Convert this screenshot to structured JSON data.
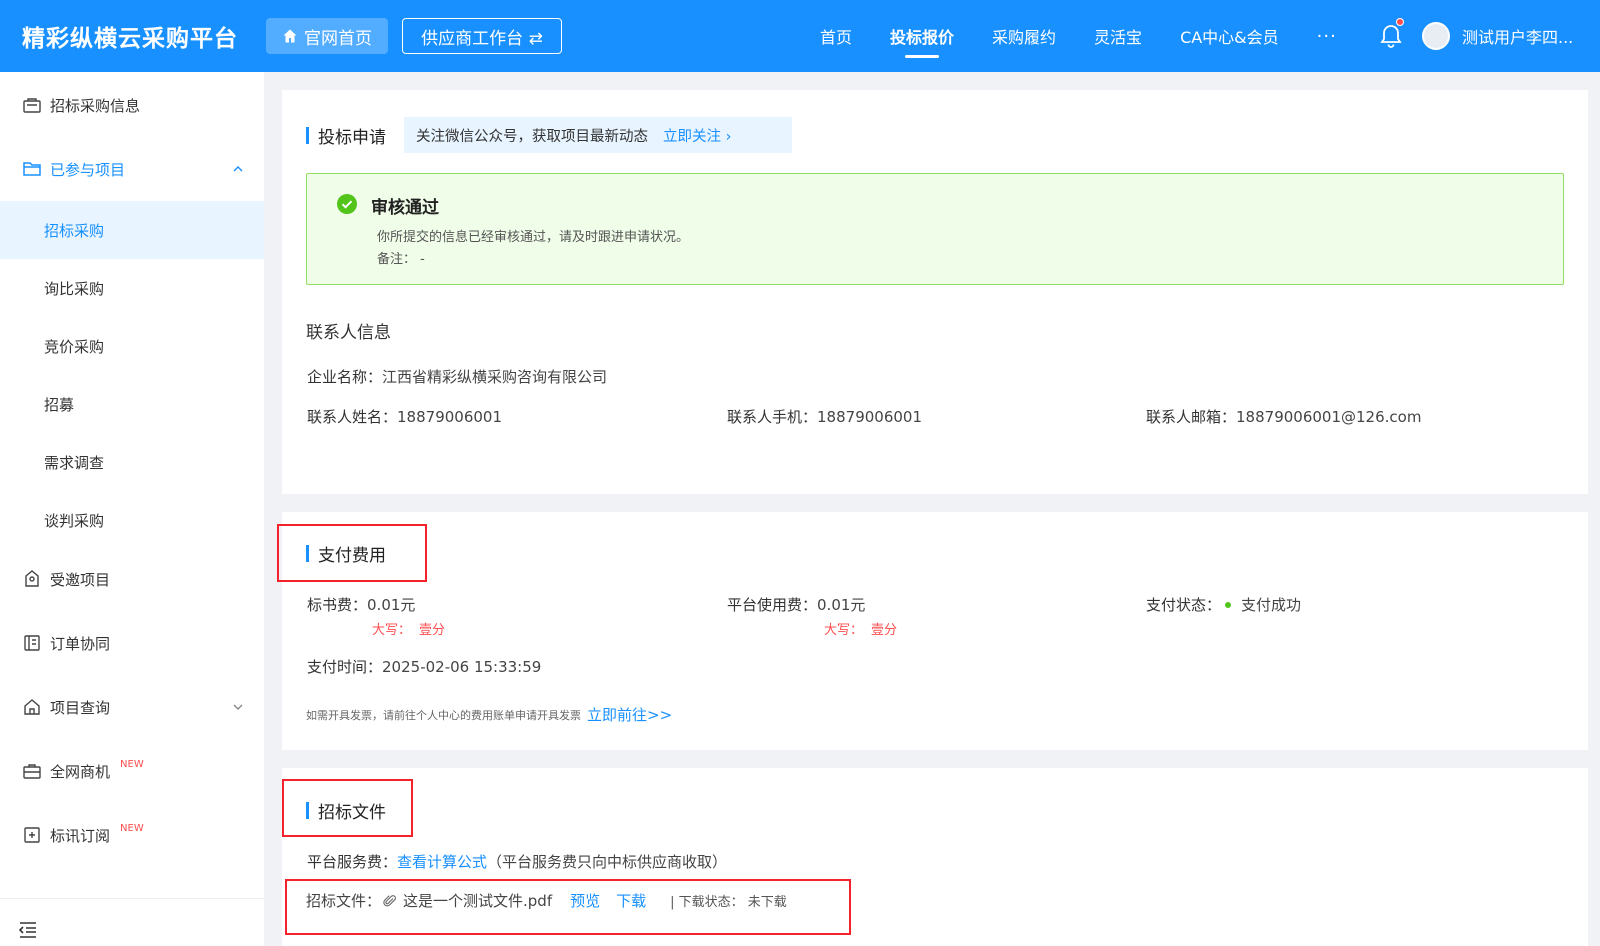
{
  "header": {
    "brand": "精彩纵横云采购平台",
    "home_btn": "官网首页",
    "workbench_btn": "供应商工作台 ⇄",
    "nav": [
      "首页",
      "投标报价",
      "采购履约",
      "灵活宝",
      "CA中心&会员"
    ],
    "nav_active": "投标报价",
    "more": "···",
    "username": "测试用户李四..."
  },
  "sidebar": {
    "items": [
      {
        "label": "招标采购信息",
        "icon": "announcement-icon"
      },
      {
        "label": "已参与项目",
        "icon": "folder-icon",
        "expanded": true
      }
    ],
    "sub_items": [
      "招标采购",
      "询比采购",
      "竞价采购",
      "招募",
      "需求调查",
      "谈判采购"
    ],
    "sub_active": "招标采购",
    "bottom_items": [
      {
        "label": "受邀项目",
        "icon": "invite-icon"
      },
      {
        "label": "订单协同",
        "icon": "book-icon"
      },
      {
        "label": "项目查询",
        "icon": "home-icon"
      },
      {
        "label": "全网商机",
        "icon": "briefcase-icon",
        "badge": "NEW"
      },
      {
        "label": "标讯订阅",
        "icon": "subscribe-icon",
        "badge": "NEW"
      }
    ]
  },
  "bid_apply": {
    "title": "投标申请",
    "notice_text": "关注微信公众号，获取项目最新动态",
    "notice_link": "立即关注 ›",
    "status_title": "审核通过",
    "status_desc": "你所提交的信息已经审核通过，请及时跟进申请状况。",
    "status_remark": "备注：  -"
  },
  "contact": {
    "title": "联系人信息",
    "company_label": "企业名称：",
    "company": "江西省精彩纵横采购咨询有限公司",
    "name_label": "联系人姓名：",
    "name": "18879006001",
    "phone_label": "联系人手机：",
    "phone": "18879006001",
    "email_label": "联系人邮箱：",
    "email": "18879006001@126.com"
  },
  "payment": {
    "title": "支付费用",
    "doc_fee_label": "标书费：",
    "doc_fee": "0.01元",
    "doc_fee_upper_label": "大写：",
    "doc_fee_upper": "壹分",
    "platform_fee_label": "平台使用费：",
    "platform_fee": "0.01元",
    "platform_fee_upper_label": "大写：",
    "platform_fee_upper": "壹分",
    "status_label": "支付状态：",
    "status": "支付成功",
    "time_label": "支付时间：",
    "time": "2025-02-06 15:33:59",
    "invoice_note": "如需开具发票，请前往个人中心的费用账单申请开具发票",
    "invoice_link": "立即前往>>"
  },
  "tender_file": {
    "title": "招标文件",
    "service_fee_label": "平台服务费：",
    "service_fee_link": "查看计算公式",
    "service_fee_note": "（平台服务费只向中标供应商收取）",
    "file_label": "招标文件：",
    "file_name": "这是一个测试文件.pdf",
    "preview": "预览",
    "download": "下载",
    "download_status": "| 下载状态：  未下载"
  },
  "colors": {
    "primary": "#1890ff",
    "success_bg": "#f0fde9",
    "success": "#52c41a",
    "danger": "#ff4d4f",
    "highlight_border": "#f5222d"
  }
}
